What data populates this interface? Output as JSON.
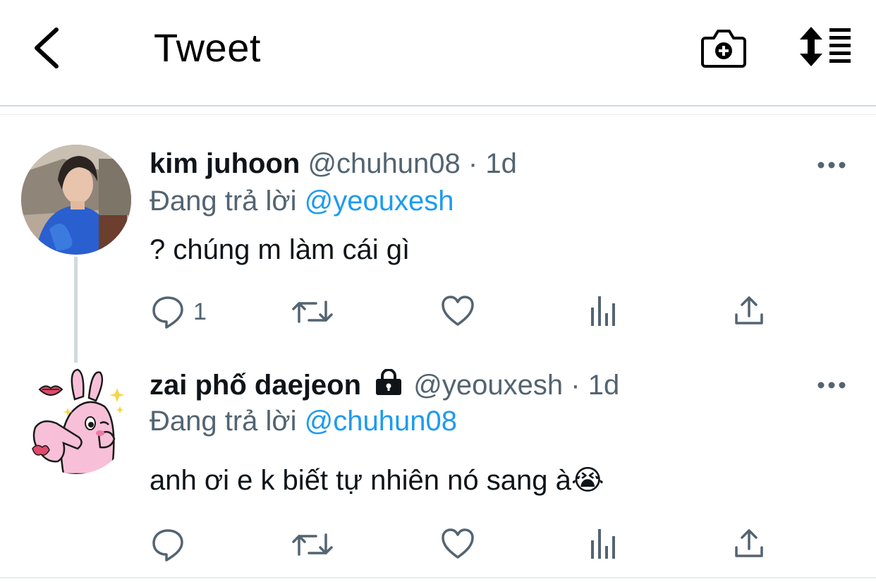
{
  "header": {
    "title": "Tweet",
    "icons": [
      "back-arrow-icon",
      "camera-plus-icon",
      "sort-list-icon"
    ]
  },
  "tweets": [
    {
      "display_name": "kim juhoon",
      "handle": "@chuhun08",
      "separator": "·",
      "time": "1d",
      "reply_prefix": "Đang trả lời",
      "reply_to": "@yeouxesh",
      "text": "? chúng m làm cái gì",
      "reply_count": "1",
      "locked": false
    },
    {
      "display_name": "zai phố daejeon",
      "handle": "@yeouxesh",
      "separator": "·",
      "time": "1d",
      "reply_prefix": "Đang trả lời",
      "reply_to": "@chuhun08",
      "text": "anh ơi e k biết tự nhiên nó sang à😭",
      "reply_count": "",
      "locked": true
    }
  ],
  "colors": {
    "accent": "#1d9bf0",
    "secondary_text": "#536471",
    "primary_text": "#0f1419",
    "divider": "#cfd9de"
  }
}
